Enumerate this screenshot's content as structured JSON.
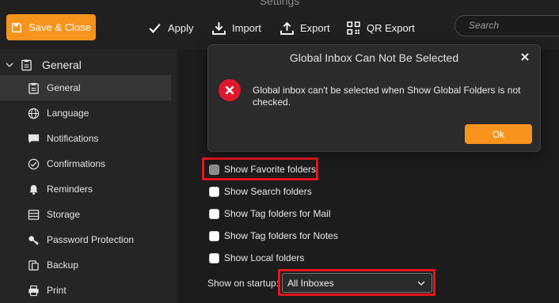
{
  "window": {
    "title": "Settings"
  },
  "toolbar": {
    "save_close_label": "Save & Close",
    "apply_label": "Apply",
    "import_label": "Import",
    "export_label": "Export",
    "qr_export_label": "QR Export",
    "search_placeholder": "Search"
  },
  "sidebar": {
    "group_label": "General",
    "items": [
      {
        "label": "General",
        "icon": "clipboard-icon",
        "selected": true
      },
      {
        "label": "Language",
        "icon": "globe-icon"
      },
      {
        "label": "Notifications",
        "icon": "message-icon"
      },
      {
        "label": "Confirmations",
        "icon": "check-circle-icon"
      },
      {
        "label": "Reminders",
        "icon": "bell-icon"
      },
      {
        "label": "Storage",
        "icon": "storage-icon"
      },
      {
        "label": "Password Protection",
        "icon": "key-icon"
      },
      {
        "label": "Backup",
        "icon": "backup-icon"
      },
      {
        "label": "Print",
        "icon": "printer-icon"
      }
    ]
  },
  "main": {
    "options": [
      {
        "label": "Show Favorite folders",
        "checked": false,
        "disabled": true
      },
      {
        "label": "Show Search folders",
        "checked": false
      },
      {
        "label": "Show Tag folders for Mail",
        "checked": false
      },
      {
        "label": "Show Tag folders for Notes",
        "checked": false
      },
      {
        "label": "Show Local folders",
        "checked": false
      }
    ],
    "startup_label": "Show on startup:",
    "startup_value": "All Inboxes"
  },
  "dialog": {
    "title": "Global Inbox Can Not Be Selected",
    "message": "Global inbox can't be selected when Show Global Folders is not checked.",
    "ok_label": "Ok"
  },
  "colors": {
    "accent": "#f7941d",
    "highlight": "#e8141e",
    "error": "#e0182b",
    "background": "#1e1e1e",
    "sidebar": "#252525"
  }
}
